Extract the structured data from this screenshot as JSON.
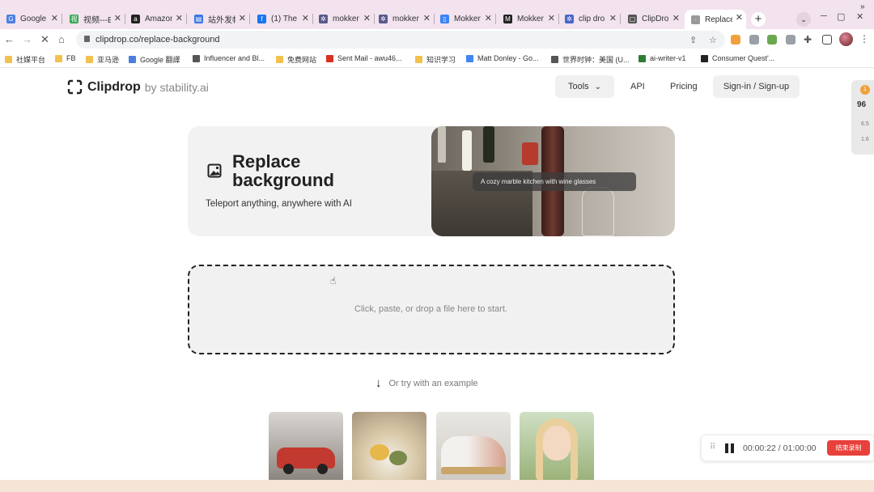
{
  "browser": {
    "tabs": [
      {
        "title": "Google",
        "color": "#4a7fe0",
        "glyph": "G"
      },
      {
        "title": "视频---EI",
        "color": "#3aa757",
        "glyph": "视"
      },
      {
        "title": "Amazon",
        "color": "#222222",
        "glyph": "a"
      },
      {
        "title": "站外发帖",
        "color": "#3b78e7",
        "glyph": "▤"
      },
      {
        "title": "(1) The",
        "color": "#1877f2",
        "glyph": "f"
      },
      {
        "title": "mokker",
        "color": "#5a5a8a",
        "glyph": "✲"
      },
      {
        "title": "mokker",
        "color": "#5a5a8a",
        "glyph": "✲"
      },
      {
        "title": "Mokker",
        "color": "#3b82f6",
        "glyph": "▯"
      },
      {
        "title": "Mokker",
        "color": "#222222",
        "glyph": "M"
      },
      {
        "title": "clip dro",
        "color": "#4a66c8",
        "glyph": "✲"
      },
      {
        "title": "ClipDro",
        "color": "#555555",
        "glyph": "▢"
      },
      {
        "title": "Replace",
        "color": "#999999",
        "glyph": "·"
      }
    ],
    "new_tab": "+",
    "url": "clipdrop.co/replace-background",
    "bookmarks": [
      {
        "label": "社媒平台",
        "color": "#f2c14e"
      },
      {
        "label": "FB",
        "color": "#f2c14e"
      },
      {
        "label": "亚马逊",
        "color": "#f2c14e"
      },
      {
        "label": "Google 翻譯",
        "color": "#4a7fe0"
      },
      {
        "label": "Influencer and Bl...",
        "color": "#555555"
      },
      {
        "label": "免费网站",
        "color": "#f2c14e"
      },
      {
        "label": "Sent Mail - awu46...",
        "color": "#d93025"
      },
      {
        "label": "知识学习",
        "color": "#f2c14e"
      },
      {
        "label": "Matt Donley - Go...",
        "color": "#4285f4"
      },
      {
        "label": "世界时钟：美国 (U...",
        "color": "#555555"
      },
      {
        "label": "ai-writer-v1",
        "color": "#2e7d32"
      },
      {
        "label": "Consumer Quest'...",
        "color": "#222222"
      }
    ],
    "bookmarks_more": "»"
  },
  "site": {
    "logo_word": "Clipdrop",
    "logo_by": "by stability.ai",
    "nav": {
      "tools": "Tools",
      "api": "API",
      "pricing": "Pricing",
      "signin": "Sign-in / Sign-up"
    }
  },
  "hero": {
    "title": "Replace background",
    "subtitle": "Teleport anything, anywhere with AI",
    "prompt_chip": "A cozy marble kitchen with wine glasses"
  },
  "dropzone": {
    "text": "Click, paste, or drop a file here to start."
  },
  "examples": {
    "label": "Or try with an example",
    "items": [
      {
        "name": "example-car",
        "color": "#c23a2f"
      },
      {
        "name": "example-food",
        "color": "#d9c9a8"
      },
      {
        "name": "example-sneaker",
        "color": "#d6a08c"
      },
      {
        "name": "example-portrait",
        "color": "#9bb27a"
      }
    ]
  },
  "recorder": {
    "time": "00:00:22 / 01:00:00",
    "stop_label": "结束录制"
  },
  "side_widget": {
    "badge": "1",
    "score": "96",
    "line1": "6.5",
    "line2": "1.6"
  },
  "colors": {
    "accent": "#e8413b",
    "tab_strip": "#f2e3ee"
  }
}
